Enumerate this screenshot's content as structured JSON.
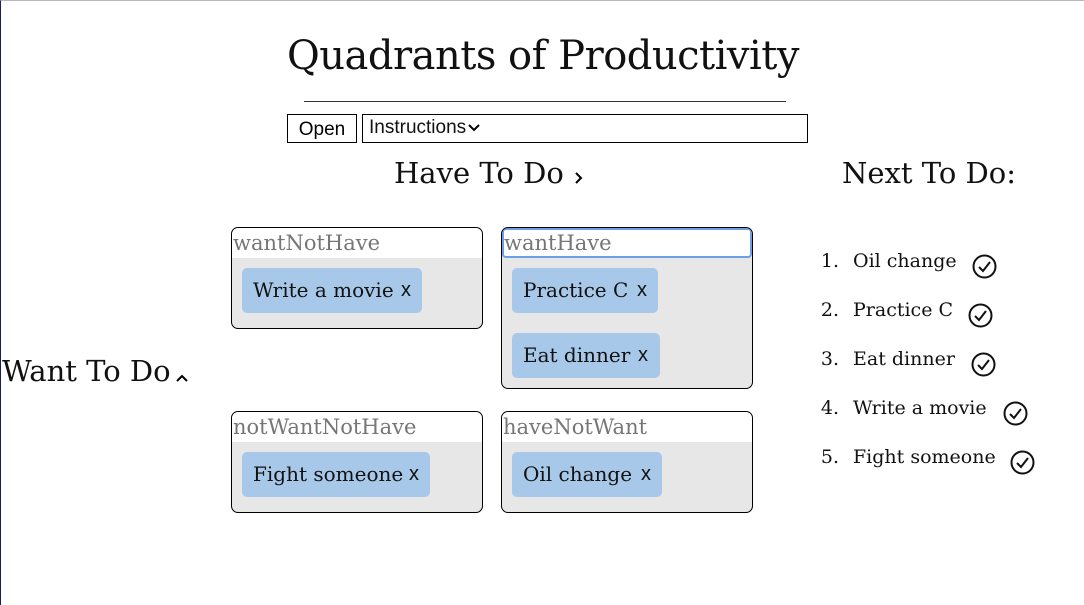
{
  "page": {
    "title": "Quadrants of Productivity"
  },
  "toolbar": {
    "open_label": "Open",
    "instructions_label": "Instructions"
  },
  "axes": {
    "have_label": "Have To Do",
    "want_label": "Want To Do"
  },
  "quadrants": [
    {
      "name": "wantNotHave",
      "tasks": [
        "Write a movie"
      ]
    },
    {
      "name": "wantHave",
      "tasks": [
        "Practice C",
        "Eat dinner"
      ]
    },
    {
      "name": "notWantNotHave",
      "tasks": [
        "Fight someone"
      ]
    },
    {
      "name": "haveNotWant",
      "tasks": [
        "Oil change"
      ]
    }
  ],
  "next": {
    "title": "Next To Do:",
    "items": [
      {
        "num": "1.",
        "text": "Oil change"
      },
      {
        "num": "2.",
        "text": "Practice C"
      },
      {
        "num": "3.",
        "text": "Eat dinner"
      },
      {
        "num": "4.",
        "text": "Write a movie"
      },
      {
        "num": "5.",
        "text": "Fight someone"
      }
    ]
  },
  "remove_label": "x",
  "icons": {
    "instructions_toggle": "chevron-down-icon",
    "have_axis_toggle": "chevron-right-icon",
    "want_axis_toggle": "chevron-up-icon",
    "complete": "check-circle-icon"
  },
  "colors": {
    "chip": "#a7c8e8",
    "quadrant_bg": "#e7e7e7",
    "quadrant_name": "#767676",
    "focus": "#6d9fe4"
  }
}
